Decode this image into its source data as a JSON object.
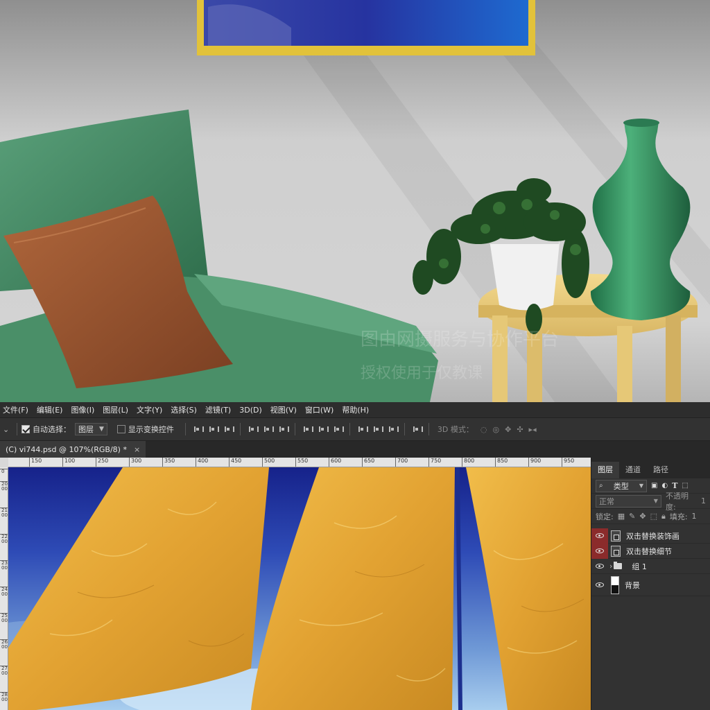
{
  "watermark": {
    "line1": "图由网摄服务与协作平台",
    "line2": "授权使用于仅教课"
  },
  "menu": [
    "文件(F)",
    "编辑(E)",
    "图像(I)",
    "图层(L)",
    "文字(Y)",
    "选择(S)",
    "滤镜(T)",
    "3D(D)",
    "视图(V)",
    "窗口(W)",
    "帮助(H)"
  ],
  "options": {
    "auto_select_label": "自动选择：",
    "auto_select_checked": true,
    "target_value": "图层",
    "show_transform_label": "显示变换控件",
    "show_transform_checked": false,
    "mode3d_label": "3D 模式："
  },
  "document": {
    "tab_title": "(C) vi744.psd @ 107%(RGB/8) *",
    "close_glyph": "×"
  },
  "ruler": {
    "h_ticks": [
      "150",
      "100",
      "250",
      "300",
      "350",
      "400",
      "450",
      "500",
      "550",
      "600",
      "650",
      "700",
      "750",
      "800",
      "850",
      "900",
      "950"
    ],
    "v_ticks": [
      "0",
      "2000",
      "2100",
      "2200",
      "2300",
      "2400",
      "2500",
      "2600",
      "2700",
      "2800"
    ]
  },
  "layers_panel": {
    "tabs": [
      "图层",
      "通道",
      "路径"
    ],
    "active_tab": "图层",
    "kind_filter": "类型",
    "blend_mode": "正常",
    "opacity_label": "不透明度:",
    "opacity_value": "1",
    "lock_label": "锁定:",
    "fill_label": "填充:",
    "fill_value": "1",
    "layers": [
      {
        "name": "双击替换装饰画",
        "type": "smart",
        "eye_red": true
      },
      {
        "name": "双击替换细节",
        "type": "smart",
        "eye_red": true
      },
      {
        "name": "组 1",
        "type": "group",
        "eye_red": false
      },
      {
        "name": "背景",
        "type": "background",
        "eye_red": false
      }
    ]
  },
  "colors": {
    "accent_red": "#8b2b2b",
    "sail_gold": "#e6a93a",
    "sky_blue": "#1b2a8a",
    "frame_yellow": "#e2c23a"
  }
}
